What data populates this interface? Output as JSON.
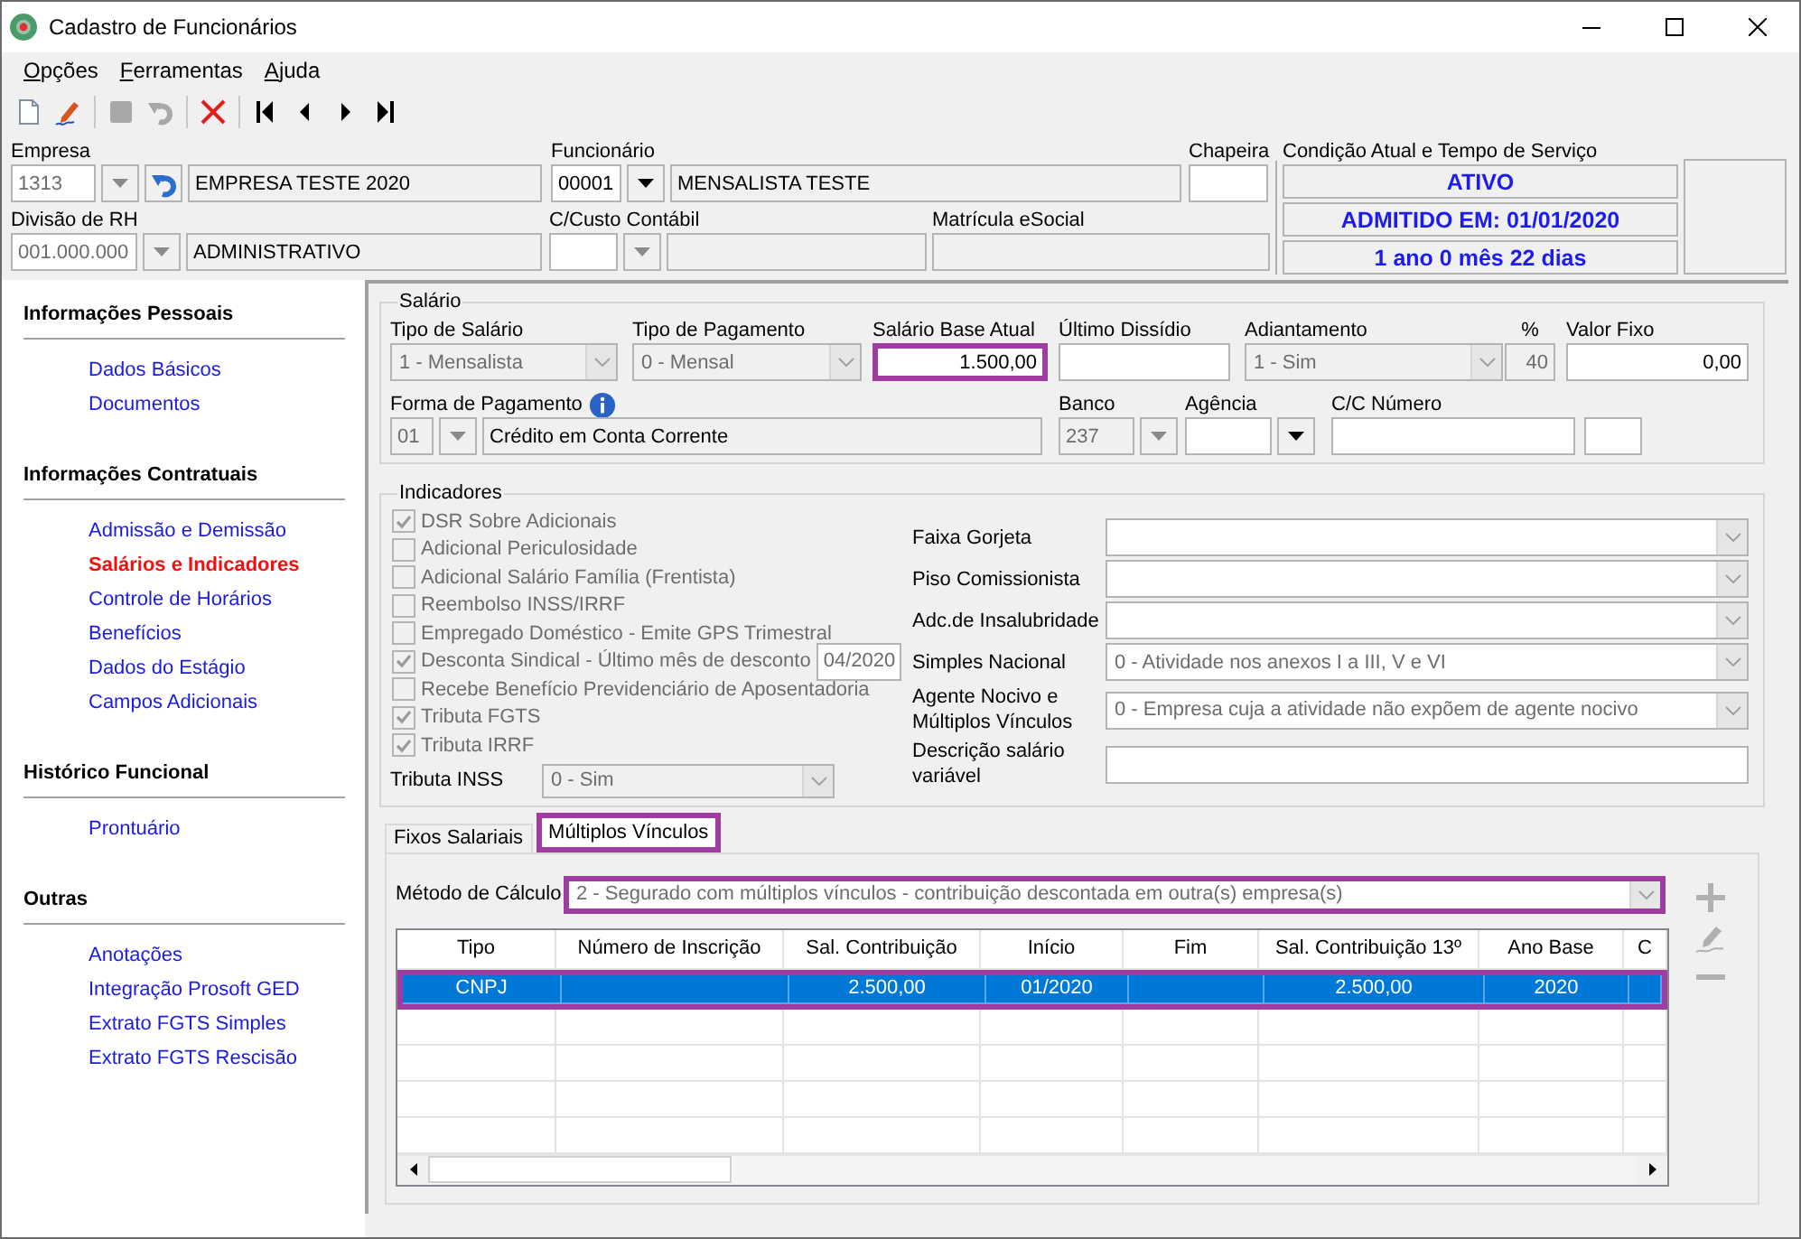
{
  "window": {
    "title": "Cadastro de Funcionários"
  },
  "menu": [
    "Opções",
    "Ferramentas",
    "Ajuda"
  ],
  "toolbar": [
    [
      {
        "kind": "new",
        "disabled": false
      },
      {
        "kind": "edit",
        "disabled": false
      }
    ],
    [
      {
        "kind": "save",
        "disabled": true
      },
      {
        "kind": "undo",
        "disabled": true
      }
    ],
    [
      {
        "kind": "delete",
        "disabled": false
      }
    ],
    [
      {
        "kind": "first",
        "disabled": false
      },
      {
        "kind": "previous",
        "disabled": false
      },
      {
        "kind": "next",
        "disabled": false
      },
      {
        "kind": "last",
        "disabled": false
      }
    ]
  ],
  "header": {
    "empresa": {
      "label": "Empresa",
      "code": "1313",
      "name": "EMPRESA TESTE 2020",
      "disabled": true
    },
    "funcionario": {
      "label": "Funcionário",
      "code": "00001",
      "name": "MENSALISTA TESTE",
      "disabled": false
    },
    "chapeira": {
      "label": "Chapeira"
    },
    "divisao": {
      "label": "Divisão de RH",
      "code": "001.000.000",
      "name": "ADMINISTRATIVO",
      "disabled": true
    },
    "custo": {
      "label": "C/Custo Contábil",
      "disabled": true
    },
    "matricula": {
      "label": "Matrícula eSocial"
    },
    "status": {
      "label": "Condição Atual e Tempo de Serviço",
      "lines": [
        "ATIVO",
        "ADMITIDO EM: 01/01/2020",
        "1 ano 0 mês 22 dias"
      ]
    }
  },
  "sidebar": {
    "sections": [
      {
        "title": "Informações Pessoais",
        "items": [
          {
            "label": "Dados Básicos",
            "selected": false
          },
          {
            "label": "Documentos",
            "selected": false
          }
        ]
      },
      {
        "title": "Informações Contratuais",
        "items": [
          {
            "label": "Admissão e Demissão",
            "selected": false
          },
          {
            "label": "Salários e Indicadores",
            "selected": true
          },
          {
            "label": "Controle de Horários",
            "selected": false
          },
          {
            "label": "Benefícios",
            "selected": false
          },
          {
            "label": "Dados do Estágio",
            "selected": false
          },
          {
            "label": "Campos Adicionais",
            "selected": false
          }
        ]
      },
      {
        "title": "Histórico Funcional",
        "items": [
          {
            "label": "Prontuário",
            "selected": false
          }
        ]
      },
      {
        "title": "Outras",
        "items": [
          {
            "label": "Anotações",
            "selected": false
          },
          {
            "label": "Integração Prosoft GED",
            "selected": false
          },
          {
            "label": "Extrato FGTS Simples",
            "selected": false
          },
          {
            "label": "Extrato FGTS Rescisão",
            "selected": false
          }
        ]
      }
    ]
  },
  "salario": {
    "title": "Salário",
    "fields": [
      {
        "kind": "combo",
        "label": "Tipo de Salário",
        "value": "1 - Mensalista"
      },
      {
        "kind": "combo",
        "label": "Tipo de Pagamento",
        "value": "0 - Mensal"
      },
      {
        "kind": "number",
        "label": "Salário Base Atual",
        "value": "1.500,00",
        "disabled": false,
        "highlighted": true
      },
      {
        "kind": "number",
        "label": "Último Dissídio",
        "disabled": false
      },
      {
        "kind": "combo",
        "label": "Adiantamento",
        "value": "1 - Sim"
      },
      {
        "kind": "number",
        "label": "%",
        "value": "40",
        "disabled": true
      },
      {
        "kind": "number",
        "label": "Valor Fixo",
        "value": "0,00",
        "disabled": false
      },
      {
        "kind": "lookup",
        "label": "Forma de Pagamento",
        "info": true,
        "code": "01",
        "name": "Crédito em Conta Corrente",
        "disabled": true
      },
      {
        "kind": "lookup",
        "label": "Banco",
        "code": "237",
        "disabled": true
      },
      {
        "kind": "lookup",
        "label": "Agência",
        "disabled": false
      },
      {
        "kind": "number",
        "label": "C/C Número",
        "disabled": false
      },
      {
        "kind": "number",
        "disabled": false
      }
    ]
  },
  "indicadores": {
    "title": "Indicadores",
    "checks": [
      {
        "label": "DSR Sobre Adicionais",
        "checked": true
      },
      {
        "label": "Adicional Periculosidade",
        "checked": false
      },
      {
        "label": "Adicional Salário Família (Frentista)",
        "checked": false
      },
      {
        "label": "Reembolso INSS/IRRF",
        "checked": false
      },
      {
        "label": "Empregado Doméstico - Emite GPS Trimestral",
        "checked": false
      },
      {
        "label": "Desconta Sindical - Último mês de desconto",
        "checked": true,
        "value": "04/2020"
      },
      {
        "label": "Recebe Benefício Previdenciário de Aposentadoria",
        "checked": false
      },
      {
        "label": "Tributa FGTS",
        "checked": true
      },
      {
        "label": "Tributa IRRF",
        "checked": true
      }
    ],
    "tributa_inss": {
      "label": "Tributa INSS",
      "value": "0 - Sim"
    },
    "right": [
      {
        "kind": "combo",
        "label": "Faixa Gorjeta"
      },
      {
        "kind": "combo",
        "label": "Piso Comissionista"
      },
      {
        "kind": "combo",
        "label": "Adc.de Insalubridade"
      },
      {
        "kind": "combo",
        "label": "Simples Nacional",
        "value": "0 - Atividade nos anexos I a III, V e VI"
      },
      {
        "kind": "combo",
        "label": "Agente Nocivo e Múltiplos Vínculos",
        "value": "0 - Empresa cuja a atividade não expõem de agente nocivo"
      },
      {
        "kind": "text",
        "label": "Descrição salário variável"
      }
    ]
  },
  "tabs": [
    {
      "label": "Fixos Salariais",
      "selected": false,
      "highlighted": false
    },
    {
      "label": "Múltiplos Vínculos",
      "selected": true,
      "highlighted": true
    }
  ],
  "vinculos": {
    "metodo": {
      "label": "Método de Cálculo",
      "value": "2 - Segurado com múltiplos vínculos - contribuição descontada em outra(s) empresa(s)",
      "highlighted": true
    },
    "actions": [
      {
        "kind": "add",
        "disabled": true
      },
      {
        "kind": "edit",
        "disabled": true
      },
      {
        "kind": "remove",
        "disabled": true
      }
    ],
    "table": {
      "columns": [
        "Tipo",
        "Número de Inscrição",
        "Sal. Contribuição",
        "Início",
        "Fim",
        "Sal. Contribuição 13º",
        "Ano Base",
        "C"
      ],
      "rows": [
        {
          "cells": [
            "CNPJ",
            null,
            "2.500,00",
            "01/2020",
            null,
            "2.500,00",
            "2020",
            null
          ],
          "selected": true,
          "highlighted": true
        }
      ]
    }
  }
}
